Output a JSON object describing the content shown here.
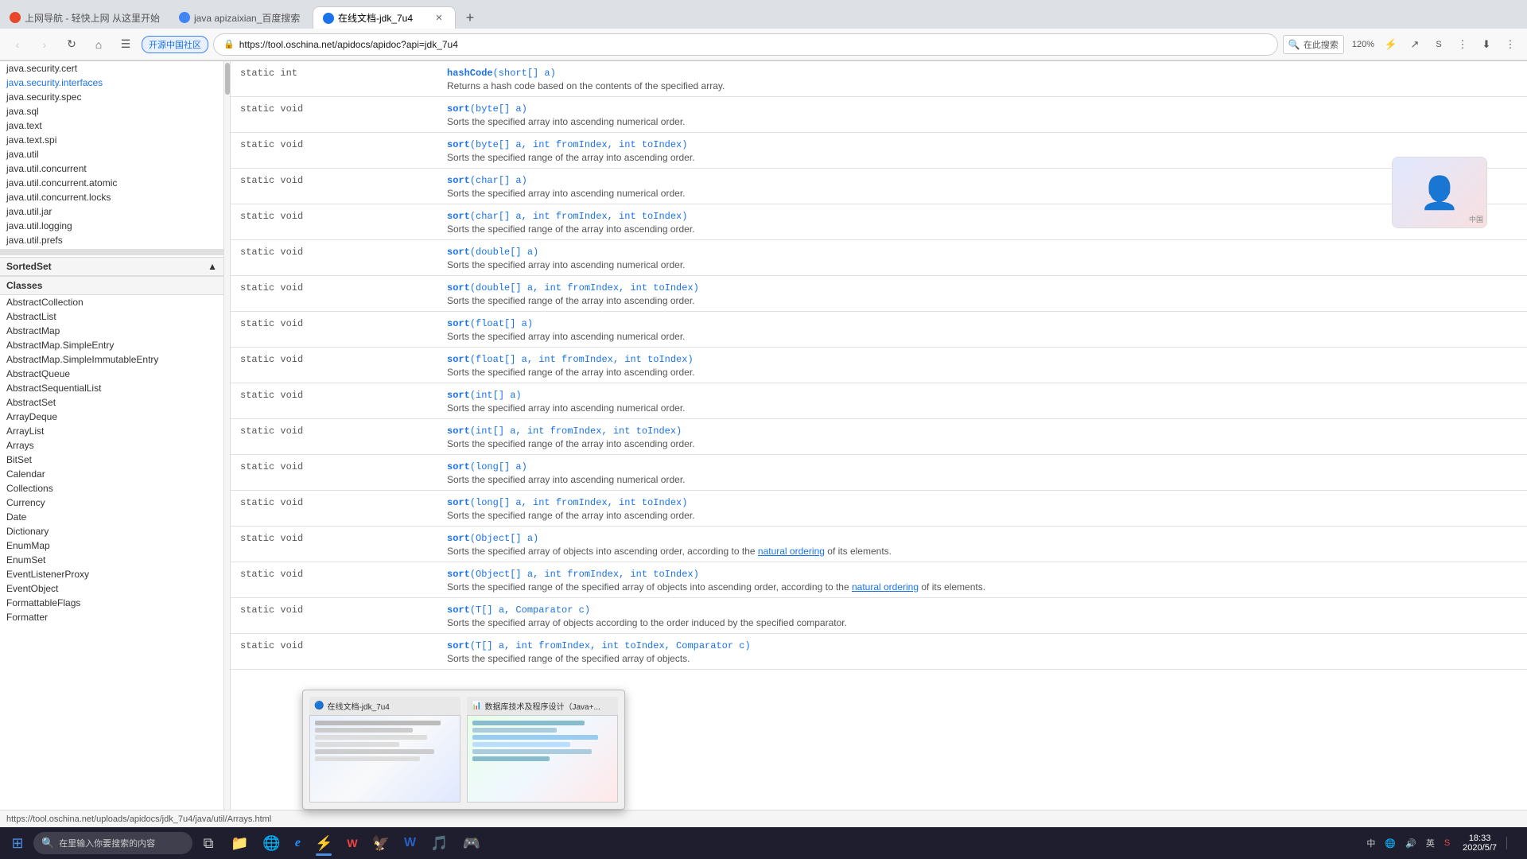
{
  "browser": {
    "tabs": [
      {
        "id": "tab1",
        "icon_color": "#e8472a",
        "title": "上网导航 - 轻快上网 从这里开始",
        "active": false,
        "icon": "🔴"
      },
      {
        "id": "tab2",
        "icon_color": "#4285f4",
        "title": "java apizaixian_百度搜索",
        "active": false,
        "icon": "🔵"
      },
      {
        "id": "tab3",
        "icon_color": "#1a73e8",
        "title": "在线文档-jdk_7u4",
        "active": true,
        "icon": "🔵"
      }
    ],
    "address": "https://tool.oschina.net/apidocs/apidoc?api=jdk_7u4",
    "zoom": "120%",
    "bookmark_label": "开源中国社区",
    "search_placeholder": "在此搜索",
    "search_label": "在此搜索"
  },
  "sidebar": {
    "sections": {
      "sorted_set": {
        "label": "SortedSet",
        "collapsed": false
      },
      "classes": {
        "label": "Classes",
        "collapsed": false
      }
    },
    "package_items": [
      "java.security.cert",
      "java.security.interfaces",
      "java.security.spec",
      "java.sql",
      "java.text",
      "java.text.spi",
      "java.util",
      "java.util.concurrent",
      "java.util.concurrent.atomic",
      "java.util.concurrent.locks",
      "java.util.jar",
      "java.util.logging",
      "java.util.prefs"
    ],
    "class_items": [
      "AbstractCollection",
      "AbstractList",
      "AbstractMap",
      "AbstractMap.SimpleEntry",
      "AbstractMap.SimpleImmutableEntry",
      "AbstractQueue",
      "AbstractSequentialList",
      "AbstractSet",
      "ArrayDeque",
      "ArrayList",
      "Arrays",
      "BitSet",
      "Calendar",
      "Collections",
      "Currency",
      "Date",
      "Dictionary",
      "EnumMap",
      "EnumSet",
      "EventListenerProxy",
      "EventObject",
      "FormattableFlags",
      "Formatter"
    ]
  },
  "api_rows": [
    {
      "modifier": "static int",
      "method": "hashCode(short[] a)",
      "description": "Returns a hash code based on the contents of the specified array."
    },
    {
      "modifier": "static void",
      "method": "sort(byte[] a)",
      "description": "Sorts the specified array into ascending numerical order."
    },
    {
      "modifier": "static void",
      "method": "sort(byte[] a, int fromIndex, int toIndex)",
      "description": "Sorts the specified range of the array into ascending order."
    },
    {
      "modifier": "static void",
      "method": "sort(char[] a)",
      "description": "Sorts the specified array into ascending numerical order."
    },
    {
      "modifier": "static void",
      "method": "sort(char[] a, int fromIndex, int toIndex)",
      "description": "Sorts the specified range of the array into ascending order."
    },
    {
      "modifier": "static void",
      "method": "sort(double[] a)",
      "description": "Sorts the specified array into ascending numerical order."
    },
    {
      "modifier": "static void",
      "method": "sort(double[] a, int fromIndex, int toIndex)",
      "description": "Sorts the specified range of the array into ascending order."
    },
    {
      "modifier": "static void",
      "method": "sort(float[] a)",
      "description": "Sorts the specified array into ascending numerical order."
    },
    {
      "modifier": "static void",
      "method": "sort(float[] a, int fromIndex, int toIndex)",
      "description": "Sorts the specified range of the array into ascending order."
    },
    {
      "modifier": "static void",
      "method": "sort(int[] a)",
      "description": "Sorts the specified array into ascending numerical order."
    },
    {
      "modifier": "static void",
      "method": "sort(int[] a, int fromIndex, int toIndex)",
      "description": "Sorts the specified range of the array into ascending order."
    },
    {
      "modifier": "static void",
      "method": "sort(long[] a)",
      "description": "Sorts the specified array into ascending numerical order."
    },
    {
      "modifier": "static void",
      "method": "sort(long[] a, int fromIndex, int toIndex)",
      "description": "Sorts the specified range of the array into ascending order."
    },
    {
      "modifier": "static void",
      "method": "sort(Object[] a)",
      "description": "Sorts the specified array of objects into ascending order, according to the natural ordering of its elements."
    },
    {
      "modifier": "static void",
      "method": "sort(Object[] a, int fromIndex, int toIndex)",
      "description": "Sorts the specified range of the specified array of objects into ascending order, according to the natural ordering of its elements."
    },
    {
      "modifier": "static void",
      "method": "sort(T[] a, Comparator c)",
      "description": "Sorts the specified array of objects according to the order induced by the specified comparator."
    },
    {
      "modifier": "static void",
      "method": "sort(T[] a, int fromIndex, int toIndex, Comparator c)",
      "description": "Sorts the specified range of the specified array of objects."
    }
  ],
  "popup": {
    "visible": true,
    "windows": [
      {
        "title": "在线文档-jdk_7u4",
        "icon": "🔵"
      },
      {
        "title": "数据库技术及程序设计（Java+...",
        "icon": "📊"
      }
    ]
  },
  "status_bar": {
    "url": "https://tool.oschina.net/uploads/apidocs/jdk_7u4/java/util/Arrays.html"
  },
  "taskbar": {
    "search_placeholder": "在里输入你要搜索的内容",
    "apps": [
      {
        "name": "windows-start",
        "icon": "⊞"
      },
      {
        "name": "search",
        "icon": "🔍"
      },
      {
        "name": "task-view",
        "icon": "⧉"
      },
      {
        "name": "explorer",
        "icon": "📁"
      },
      {
        "name": "edge",
        "icon": "🌐"
      },
      {
        "name": "ie",
        "icon": "ℯ"
      },
      {
        "name": "chrome",
        "icon": "⚡"
      },
      {
        "name": "wps",
        "icon": "W"
      },
      {
        "name": "ie2",
        "icon": "e"
      },
      {
        "name": "word",
        "icon": "W"
      },
      {
        "name": "app1",
        "icon": "🦅"
      },
      {
        "name": "app2",
        "icon": "🎮"
      }
    ],
    "clock": {
      "time": "18:33",
      "date": "2020/5/7"
    },
    "tray": {
      "items": [
        "中",
        "英",
        "Σ"
      ]
    }
  },
  "natural_ordering_text": "natural ordering"
}
